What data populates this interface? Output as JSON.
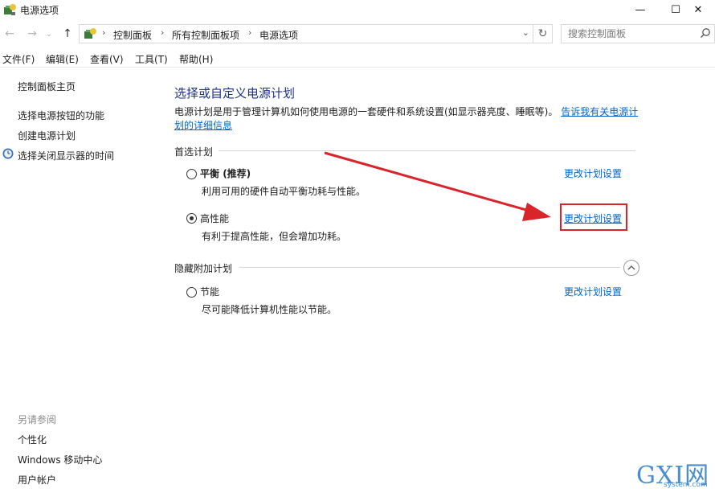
{
  "window": {
    "title": "电源选项",
    "minimize_glyph": "—",
    "maximize_glyph": "☐",
    "close_glyph": "✕"
  },
  "nav": {
    "back_glyph": "←",
    "forward_glyph": "→",
    "recent_glyph": "⌄",
    "up_glyph": "↑",
    "breadcrumb": [
      "控制面板",
      "所有控制面板项",
      "电源选项"
    ],
    "separator": "›",
    "dropdown_glyph": "⌄",
    "refresh_glyph": "↻",
    "search_placeholder": "搜索控制面板"
  },
  "menubar": {
    "items": [
      "文件(F)",
      "编辑(E)",
      "查看(V)",
      "工具(T)",
      "帮助(H)"
    ]
  },
  "sidebar": {
    "home": "控制面板主页",
    "links": [
      "选择电源按钮的功能",
      "创建电源计划",
      "选择关闭显示器的时间"
    ],
    "see_also_title": "另请参阅",
    "see_also": [
      "个性化",
      "Windows 移动中心",
      "用户帐户"
    ]
  },
  "main": {
    "title": "选择或自定义电源计划",
    "description": "电源计划是用于管理计算机如何使用电源的一套硬件和系统设置(如显示器亮度、睡眠等)。",
    "description_link_1": "告诉我有关电源计",
    "description_link_2": "划的详细信息",
    "preferred_group": "首选计划",
    "hidden_group": "隐藏附加计划",
    "plans": [
      {
        "name": "平衡",
        "tag": " (推荐)",
        "desc": "利用可用的硬件自动平衡功耗与性能。",
        "link": "更改计划设置",
        "selected": false
      },
      {
        "name": "高性能",
        "tag": "",
        "desc": "有利于提高性能，但会增加功耗。",
        "link": "更改计划设置",
        "selected": true
      },
      {
        "name": "节能",
        "tag": "",
        "desc": "尽可能降低计算机性能以节能。",
        "link": "更改计划设置",
        "selected": false
      }
    ]
  },
  "annotation": {
    "color": "#d9242b"
  },
  "watermark": {
    "text": "GXI网",
    "sub": "system.com"
  },
  "colors": {
    "title": "#1e3287",
    "link": "#0066cc",
    "accent_red": "#d9242b"
  }
}
